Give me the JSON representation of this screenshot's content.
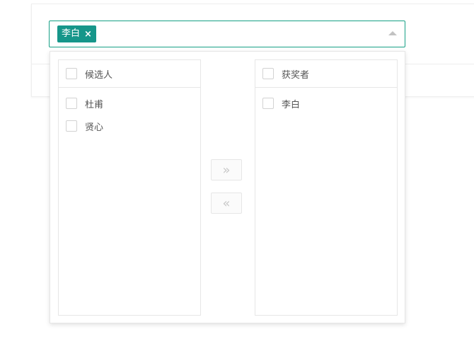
{
  "select": {
    "selected_tags": [
      {
        "label": "李白",
        "close_glyph": "×"
      }
    ]
  },
  "transfer": {
    "left": {
      "header": "候选人",
      "items": [
        "杜甫",
        "贤心"
      ]
    },
    "right": {
      "header": "获奖者",
      "items": [
        "李白"
      ]
    },
    "to_right_glyph": "»",
    "to_left_glyph": "«"
  },
  "colors": {
    "accent": "#16968a",
    "border_focus": "#16a085"
  },
  "icons": {
    "dropdown_arrow": "triangle-up-icon",
    "move_right": "double-chevron-right-icon",
    "move_left": "double-chevron-left-icon"
  }
}
